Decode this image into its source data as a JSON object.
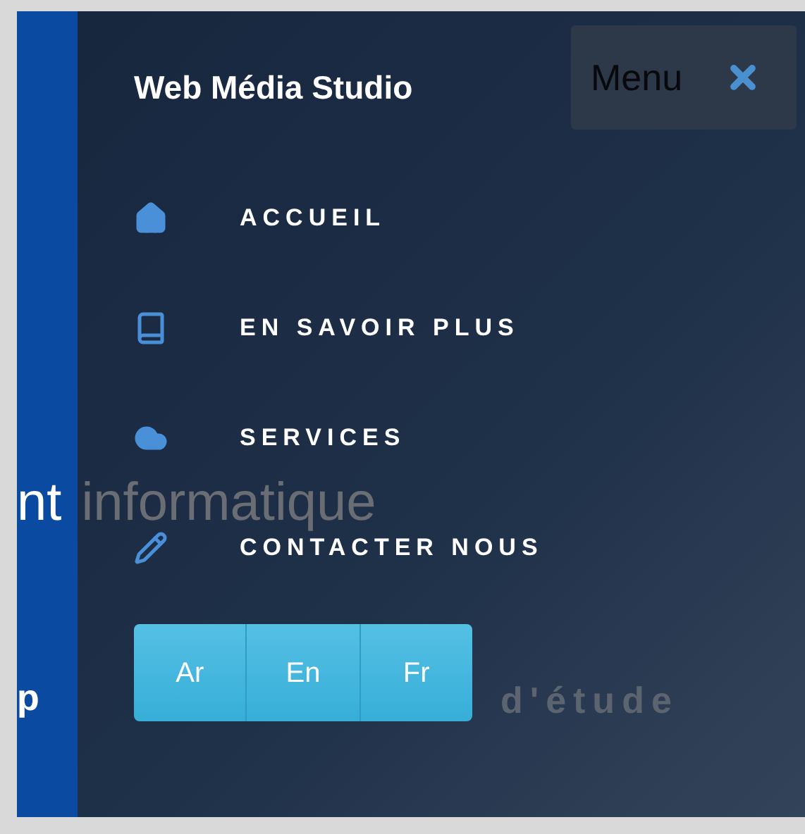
{
  "background": {
    "headline": [
      "nt",
      "informatique"
    ],
    "subtitle": [
      "p",
      "d'étude"
    ]
  },
  "title": "Web Média Studio",
  "menu_button": {
    "label": "Menu"
  },
  "nav": [
    {
      "label": "ACCUEIL"
    },
    {
      "label": "EN SAVOIR PLUS"
    },
    {
      "label": "SERVICES"
    },
    {
      "label": "CONTACTER NOUS"
    }
  ],
  "languages": [
    {
      "label": "Ar"
    },
    {
      "label": "En"
    },
    {
      "label": "Fr"
    }
  ]
}
